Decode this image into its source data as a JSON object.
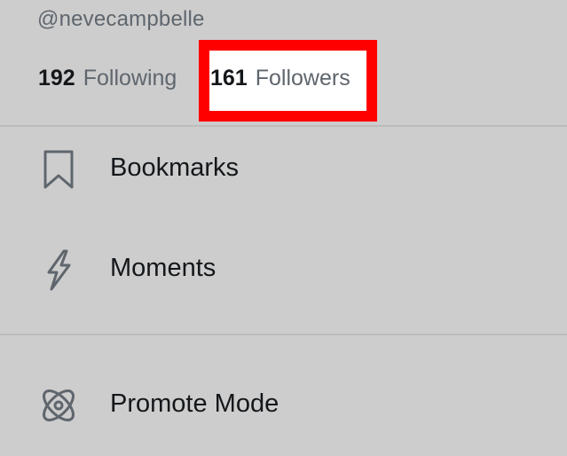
{
  "profile": {
    "handle": "@nevecampbelle",
    "following_count": "192",
    "following_label": "Following",
    "followers_count": "161",
    "followers_label": "Followers"
  },
  "menu": {
    "items": [
      {
        "label": "Bookmarks",
        "icon": "bookmark-icon"
      },
      {
        "label": "Moments",
        "icon": "lightning-bolt-icon"
      },
      {
        "label": "Promote Mode",
        "icon": "promote-mode-icon"
      }
    ]
  },
  "colors": {
    "background": "#cdcdcd",
    "highlight_border": "#ff0000",
    "primary_text": "#14171a",
    "secondary_text": "#5f666d"
  }
}
